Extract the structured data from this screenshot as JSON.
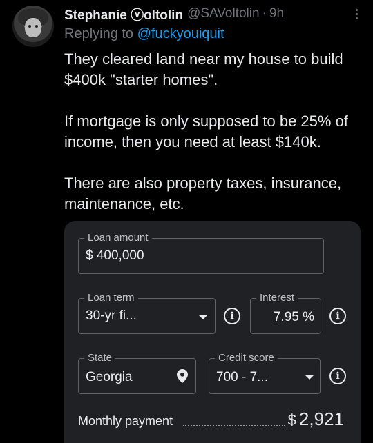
{
  "tweet": {
    "author_name": "Stephanie ⓥoltolin",
    "author_handle": "@SAVoltolin",
    "separator": "·",
    "time": "9h",
    "replying_prefix": "Replying to",
    "replying_to": "@fuckyouiquit",
    "paragraphs": [
      "They cleared land near my house to build $400k \"starter homes\".",
      "If mortgage is only supposed to be 25% of income, then you need at least $140k.",
      "There are also property taxes, insurance, maintenance, etc."
    ]
  },
  "calculator": {
    "loan_amount": {
      "label": "Loan amount",
      "value": "$ 400,000"
    },
    "loan_term": {
      "label": "Loan term",
      "value": "30-yr fi..."
    },
    "interest": {
      "label": "Interest",
      "value": "7.95 %"
    },
    "state": {
      "label": "State",
      "value": "Georgia"
    },
    "credit_score": {
      "label": "Credit score",
      "value": "700 - 7..."
    },
    "info_glyph": "i",
    "monthly_payment": {
      "label": "Monthly payment",
      "currency": "$",
      "value": "2,921"
    }
  }
}
